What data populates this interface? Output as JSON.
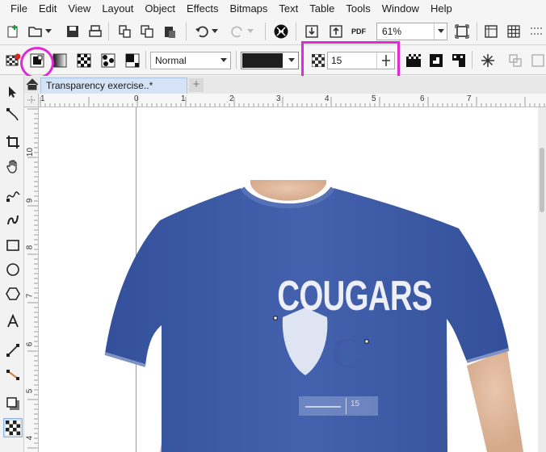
{
  "menu": [
    "File",
    "Edit",
    "View",
    "Layout",
    "Object",
    "Effects",
    "Bitmaps",
    "Text",
    "Table",
    "Tools",
    "Window",
    "Help"
  ],
  "toolbar": {
    "zoom": "61%",
    "pdf_label": "PDF"
  },
  "property_bar": {
    "merge_mode": "Normal",
    "transparency_value": "15"
  },
  "document": {
    "tab_title": "Transparency exercise..*"
  },
  "ruler": {
    "top_labels": [
      "1",
      "0",
      "1",
      "2",
      "3",
      "4",
      "5",
      "6",
      "7"
    ],
    "left_labels": [
      "10",
      "9",
      "8",
      "7",
      "6",
      "5",
      "4"
    ]
  },
  "shirt": {
    "text": "COUGARS",
    "emblem": "C",
    "slider_value": "15"
  },
  "colors": {
    "shirt": "#3f5aa6",
    "highlight": "#e02ad6",
    "tab": "#d4e3f5"
  }
}
